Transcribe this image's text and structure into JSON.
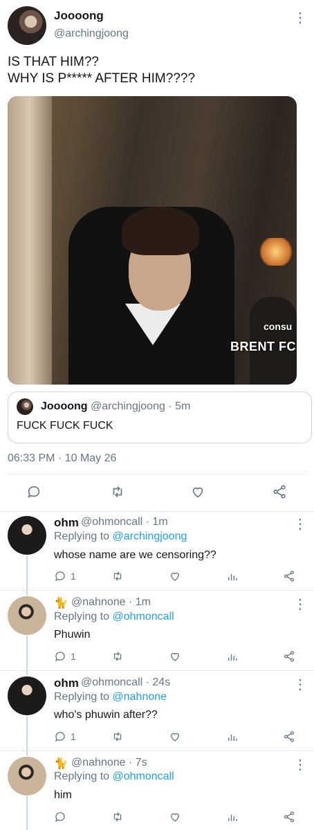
{
  "main_tweet": {
    "name": "Joooong",
    "handle": "@archingjoong",
    "text_line1": "IS THAT HIM??",
    "text_line2": "WHY IS P***** AFTER HIM????",
    "media_caption_line1": "consu",
    "media_caption_line2": "BRENT FC",
    "quote": {
      "name": "Joooong",
      "handle_time": "@archingjoong · 5m",
      "text": "FUCK FUCK FUCK"
    },
    "timestamp": "06:33 PM · 10 May 26"
  },
  "replies": [
    {
      "name": "ohm",
      "handle_time": "@ohmoncall · 1m",
      "replying_prefix": "Replying to ",
      "replying_to": "@archingjoong",
      "text": "whose name are we censoring??",
      "reply_count": "1",
      "emoji": ""
    },
    {
      "name": "",
      "handle_time": "@nahnone · 1m",
      "replying_prefix": "Replying to ",
      "replying_to": "@ohmoncall",
      "text": "Phuwin",
      "reply_count": "1",
      "emoji": "🐈"
    },
    {
      "name": "ohm",
      "handle_time": "@ohmoncall · 24s",
      "replying_prefix": "Replying to ",
      "replying_to": "@nahnone",
      "text": "who's phuwin after??",
      "reply_count": "1",
      "emoji": ""
    },
    {
      "name": "",
      "handle_time": "@nahnone · 7s",
      "replying_prefix": "Replying to ",
      "replying_to": "@ohmoncall",
      "text": "him",
      "reply_count": "",
      "emoji": "🐈"
    }
  ],
  "icons": {
    "reply": "reply-icon",
    "retweet": "retweet-icon",
    "like": "heart-icon",
    "analytics": "analytics-icon",
    "share": "share-icon",
    "more": "more-vertical-icon"
  },
  "colors": {
    "link": "#1da1f2",
    "secondary_text": "#657786",
    "divider": "#e1e8ed"
  }
}
